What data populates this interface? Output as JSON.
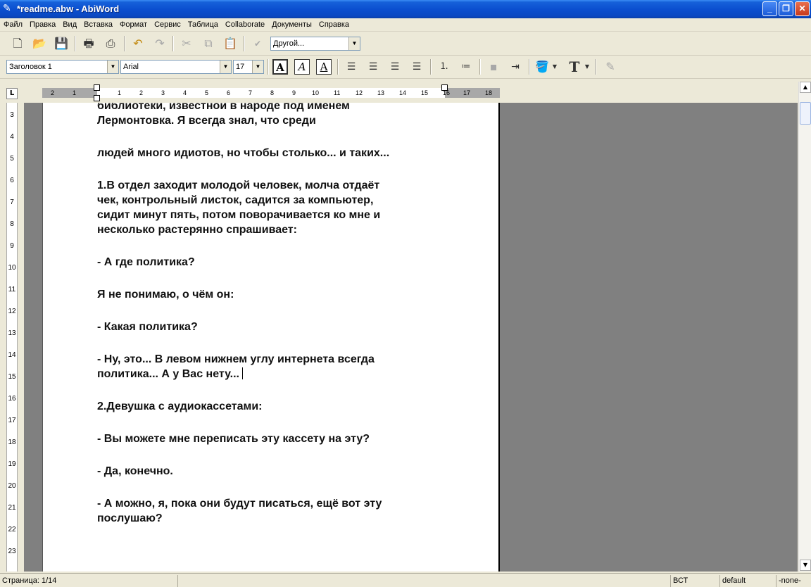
{
  "window": {
    "title": "*readme.abw - AbiWord"
  },
  "menu": [
    "Файл",
    "Правка",
    "Вид",
    "Вставка",
    "Формат",
    "Сервис",
    "Таблица",
    "Collaborate",
    "Документы",
    "Справка"
  ],
  "toolbar": {
    "zoom_value": "Другой..."
  },
  "format": {
    "style_value": "Заголовок 1",
    "font_value": "Arial",
    "size_value": "17"
  },
  "ruler": {
    "h_ticks": [
      "2",
      "1",
      "1",
      "2",
      "3",
      "4",
      "5",
      "6",
      "7",
      "8",
      "9",
      "10",
      "11",
      "12",
      "13",
      "14",
      "15",
      "16",
      "17",
      "18"
    ],
    "v_ticks": [
      "3",
      "4",
      "5",
      "6",
      "7",
      "8",
      "9",
      "10",
      "11",
      "12",
      "13",
      "14",
      "15",
      "16",
      "17",
      "18",
      "19",
      "20",
      "21",
      "22",
      "23"
    ]
  },
  "document": {
    "lines": [
      "библиотеки, известной в народе под именем",
      "Лермонтовка. Я всегда знал, что среди",
      "людей много идиотов, но чтобы столько... и таких...",
      "1.В отдел заходит молодой человек, молча отдаёт",
      "чек, контрольный листок, садится за компьютер,",
      "сидит минут пять, потом поворачивается ко мне и",
      "несколько растерянно спрашивает:",
      "- А где политика?",
      "Я не понимаю, о чём он:",
      "- Какая политика?",
      "- Ну, это... В левом нижнем углу интернета всегда",
      "политика... А у Вас нету...",
      "2.Девушка с аудиокассетами:",
      "- Вы можете мне переписать эту кассету на эту?",
      "- Да, конечно.",
      "- А можно, я, пока они будут писаться, ещё вот эту",
      "послушаю?"
    ]
  },
  "status": {
    "page": "Страница: 1/14",
    "mode": "ВСТ",
    "lang": "default",
    "extra": "-none-"
  }
}
